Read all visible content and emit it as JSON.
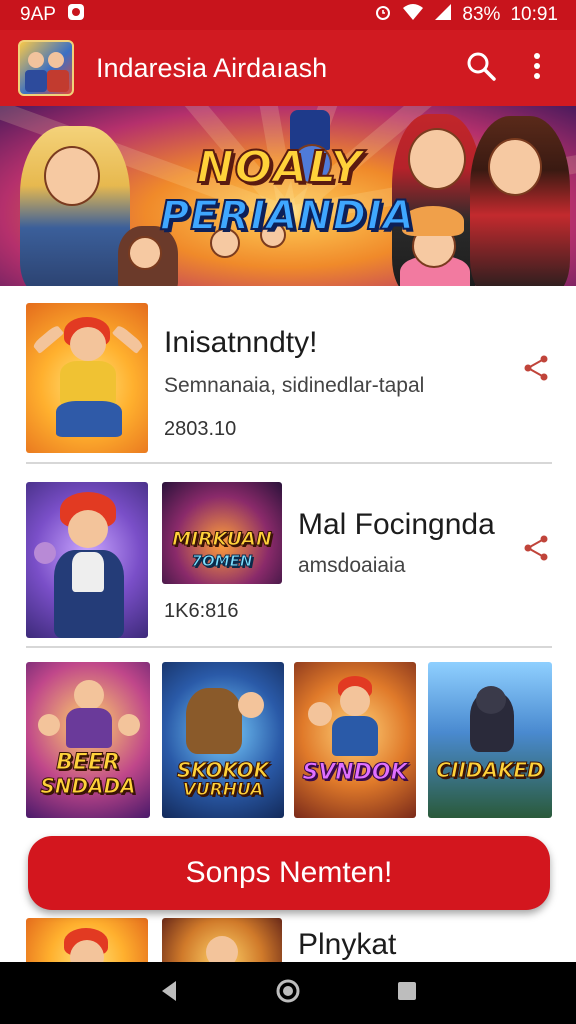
{
  "status_bar": {
    "left_text": "9AP",
    "battery": "83%",
    "time": "10:91",
    "icons": [
      "notification-icon",
      "alarm-icon",
      "wifi-icon",
      "signal-icon"
    ]
  },
  "app_bar": {
    "title": "Indaresia Airdaıash",
    "icons": [
      "search-icon",
      "more-vert-icon"
    ]
  },
  "banner": {
    "title_line1": "NOALY",
    "title_line2": "PERIANDIA"
  },
  "items": [
    {
      "title": "Inisatnndty!",
      "subtitle": "Semnanaia, sidinedlar-tapal",
      "meta": "2803.10",
      "action_icon": "share-icon"
    },
    {
      "title": "Mal Focingnda",
      "subtitle": "amsdoaiaia",
      "meta": "1K6:816",
      "thumb_label_1": "MIRKUAN",
      "thumb_label_2": "7OMEN",
      "action_icon": "share-icon"
    },
    {
      "title": "Plnykat"
    }
  ],
  "tiles": [
    {
      "label_1": "BEER",
      "label_2": "SNDADA"
    },
    {
      "label_1": "SKOKOK",
      "label_2": "VURHUA"
    },
    {
      "label_1": "SVNDOK",
      "label_2": ""
    },
    {
      "label_1": "CIIDAKED",
      "label_2": ""
    }
  ],
  "primary_button": {
    "label": "Sonps Nemten!"
  },
  "nav_bar": {
    "icons": [
      "back-icon",
      "home-icon",
      "recents-icon"
    ]
  },
  "colors": {
    "accent": "#d11a21",
    "status_bar": "#c8141c",
    "share_icon": "#c0443a"
  }
}
